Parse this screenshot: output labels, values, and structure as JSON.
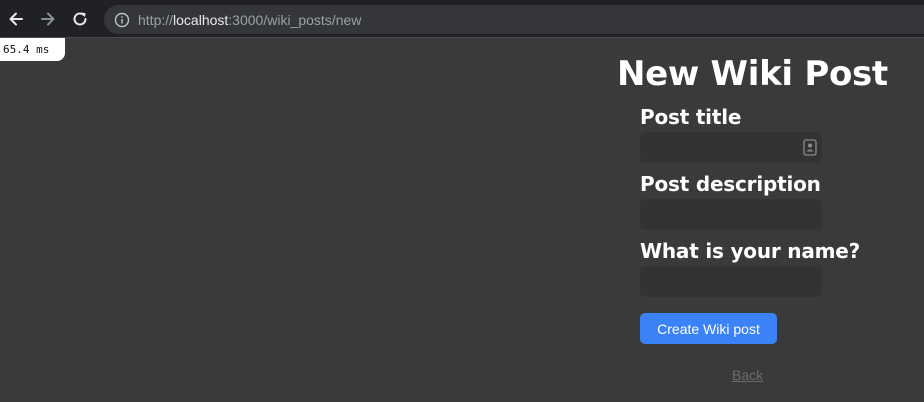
{
  "browser": {
    "url_scheme": "http://",
    "url_host": "localhost",
    "url_path": ":3000/wiki_posts/new"
  },
  "timing": {
    "label": "65.4 ms"
  },
  "form": {
    "title": "New Wiki Post",
    "fields": [
      {
        "label": "Post title",
        "value": "",
        "placeholder": ""
      },
      {
        "label": "Post description",
        "value": "",
        "placeholder": ""
      },
      {
        "label": "What is your name?",
        "value": "",
        "placeholder": ""
      }
    ],
    "submit_label": "Create Wiki post",
    "back_label": "Back"
  },
  "colors": {
    "page_background": "#3a3a3a",
    "input_background": "#333333",
    "accent": "#3b82f6",
    "link_muted": "#6b6b6b"
  },
  "icons": {
    "back": "arrow-left-icon",
    "forward": "arrow-right-icon",
    "reload": "reload-icon",
    "site_info": "info-circle-icon",
    "autofill": "contact-card-icon"
  }
}
